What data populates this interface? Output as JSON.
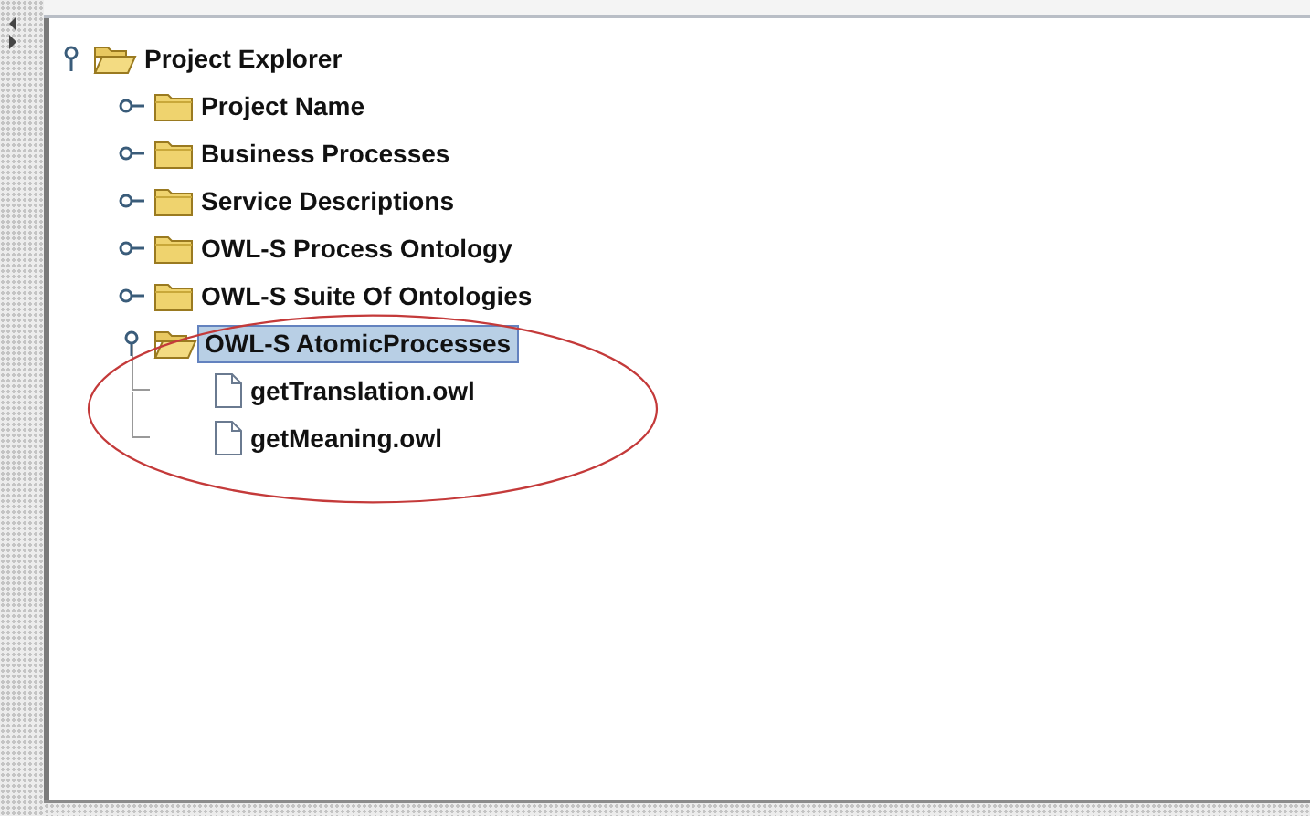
{
  "tree": {
    "label": "Project Explorer",
    "kind": "folder",
    "expanded": true,
    "selected": false,
    "children": [
      {
        "label": "Project Name",
        "kind": "folder",
        "expanded": false,
        "selected": false
      },
      {
        "label": "Business Processes",
        "kind": "folder",
        "expanded": false,
        "selected": false
      },
      {
        "label": "Service Descriptions",
        "kind": "folder",
        "expanded": false,
        "selected": false
      },
      {
        "label": "OWL-S Process Ontology",
        "kind": "folder",
        "expanded": false,
        "selected": false
      },
      {
        "label": "OWL-S Suite Of Ontologies",
        "kind": "folder",
        "expanded": false,
        "selected": false
      },
      {
        "label": "OWL-S AtomicProcesses",
        "kind": "folder",
        "expanded": true,
        "selected": true,
        "children": [
          {
            "label": "getTranslation.owl",
            "kind": "file",
            "selected": false
          },
          {
            "label": "getMeaning.owl",
            "kind": "file",
            "selected": false
          }
        ]
      }
    ]
  }
}
